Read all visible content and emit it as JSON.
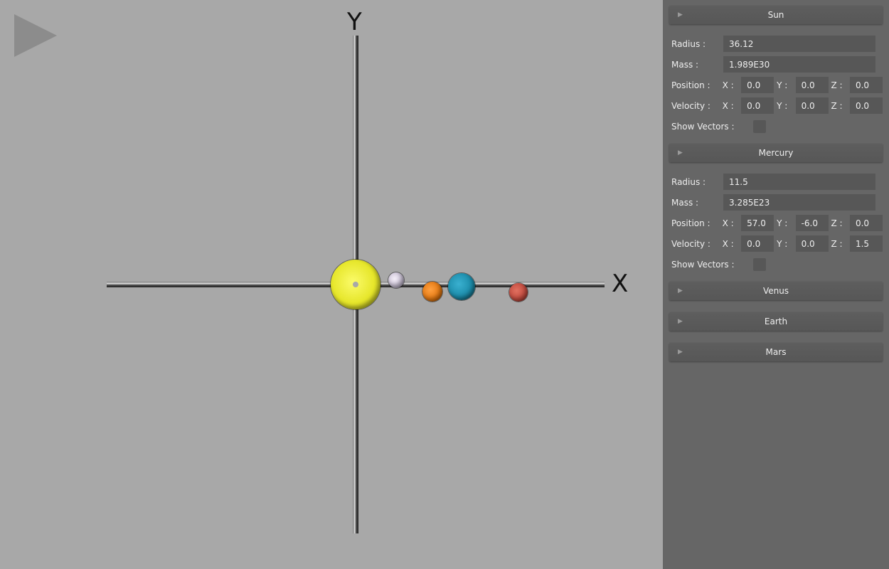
{
  "viewport": {
    "axis_y": "Y",
    "axis_x": "X",
    "play_icon": "play-icon"
  },
  "planet_colors": {
    "sun": "#e6e62a",
    "mercury": "#c9c0d4",
    "venus": "#e27710",
    "earth": "#1a8aa8",
    "mars": "#c24a3e"
  },
  "panel": {
    "sun": {
      "title": "Sun",
      "radius_label": "Radius :",
      "radius": "36.12",
      "mass_label": "Mass :",
      "mass": "1.989E30",
      "position_label": "Position :",
      "position": {
        "x": "0.0",
        "y": "0.0",
        "z": "0.0"
      },
      "velocity_label": "Velocity :",
      "velocity": {
        "x": "0.0",
        "y": "0.0",
        "z": "0.0"
      },
      "vectors_label": "Show Vectors :"
    },
    "mercury": {
      "title": "Mercury",
      "radius_label": "Radius :",
      "radius": "11.5",
      "mass_label": "Mass :",
      "mass": "3.285E23",
      "position_label": "Position :",
      "position": {
        "x": "57.0",
        "y": "-6.0",
        "z": "0.0"
      },
      "velocity_label": "Velocity :",
      "velocity": {
        "x": "0.0",
        "y": "0.0",
        "z": "1.5"
      },
      "vectors_label": "Show Vectors :"
    },
    "venus": {
      "title": "Venus"
    },
    "earth": {
      "title": "Earth"
    },
    "mars": {
      "title": "Mars"
    },
    "coord_labels": {
      "x": "X :",
      "y": "Y :",
      "z": "Z :"
    },
    "arrow": "▶"
  }
}
